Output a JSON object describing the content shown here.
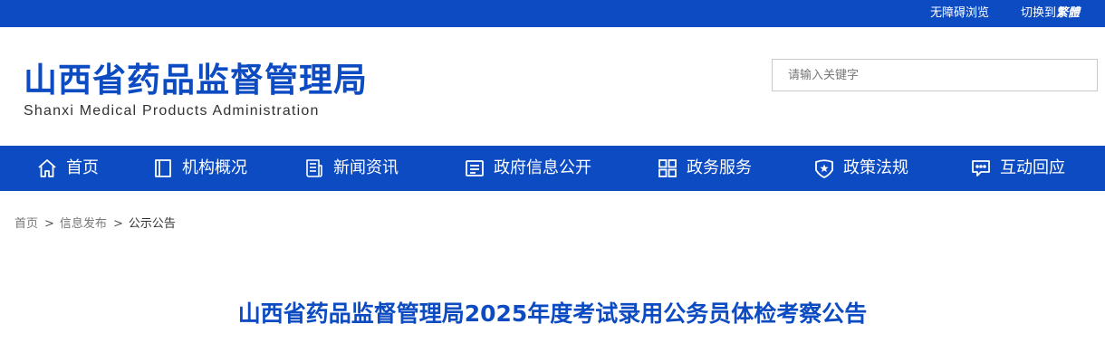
{
  "topbar": {
    "accessibility_label": "无障碍浏览",
    "switch_prefix": "切换到",
    "switch_target": "繁體"
  },
  "header": {
    "logo_title": "山西省药品监督管理局",
    "logo_subtitle": "Shanxi Medical Products Administration",
    "search_placeholder": "请输入关键字"
  },
  "nav": {
    "items": [
      {
        "label": "首页",
        "icon": "home-icon"
      },
      {
        "label": "机构概况",
        "icon": "book-icon"
      },
      {
        "label": "新闻资讯",
        "icon": "newspaper-icon"
      },
      {
        "label": "政府信息公开",
        "icon": "document-list-icon"
      },
      {
        "label": "政务服务",
        "icon": "grid-icon"
      },
      {
        "label": "政策法规",
        "icon": "shield-star-icon"
      },
      {
        "label": "互动回应",
        "icon": "chat-icon"
      }
    ]
  },
  "breadcrumb": {
    "items": [
      "首页",
      "信息发布",
      "公示公告"
    ],
    "separator": ">"
  },
  "article": {
    "title": "山西省药品监督管理局2025年度考试录用公务员体检考察公告"
  },
  "colors": {
    "brand_blue": "#0d4bc2",
    "text_gray": "#777777"
  }
}
